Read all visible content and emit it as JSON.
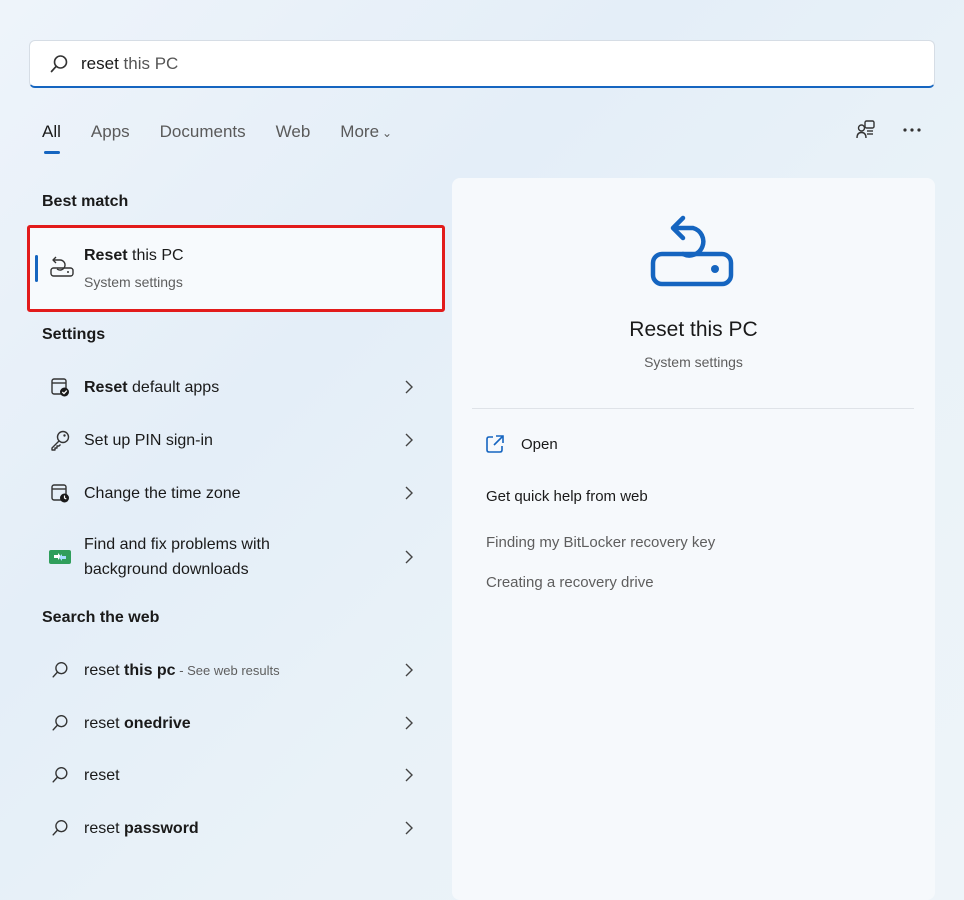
{
  "search": {
    "query_typed": "reset",
    "query_suggestion": " this PC"
  },
  "tabs": [
    {
      "label": "All",
      "active": true
    },
    {
      "label": "Apps"
    },
    {
      "label": "Documents"
    },
    {
      "label": "Web"
    },
    {
      "label": "More"
    }
  ],
  "top_icons": [
    "share-icon",
    "more-options-icon"
  ],
  "best_match": {
    "section_title": "Best match",
    "title_bold": "Reset",
    "title_rest": " this PC",
    "subtitle": "System settings",
    "icon": "reset-pc-icon"
  },
  "settings": {
    "section_title": "Settings",
    "items": [
      {
        "bold": "Reset",
        "rest": " default apps",
        "icon": "default-apps-icon"
      },
      {
        "bold": "",
        "rest": "Set up PIN sign-in",
        "icon": "key-icon"
      },
      {
        "bold": "",
        "rest": "Change the time zone",
        "icon": "clock-icon"
      },
      {
        "bold": "",
        "rest": "Find and fix problems with",
        "rest2": "background downloads",
        "icon": "troubleshoot-icon"
      }
    ]
  },
  "web": {
    "section_title": "Search the web",
    "items": [
      {
        "plain": "reset ",
        "bold": "this pc",
        "hint": " - See web results"
      },
      {
        "plain": "reset ",
        "bold": "onedrive",
        "hint": ""
      },
      {
        "plain": "reset",
        "bold": "",
        "hint": ""
      },
      {
        "plain": "reset ",
        "bold": "password",
        "hint": ""
      }
    ]
  },
  "detail": {
    "title": "Reset this PC",
    "subtitle": "System settings",
    "open_label": "Open",
    "help_title": "Get quick help from web",
    "help_links": [
      "Finding my BitLocker recovery key",
      "Creating a recovery drive"
    ]
  },
  "colors": {
    "accent": "#1565c0",
    "highlight_border": "#e21b1b"
  }
}
